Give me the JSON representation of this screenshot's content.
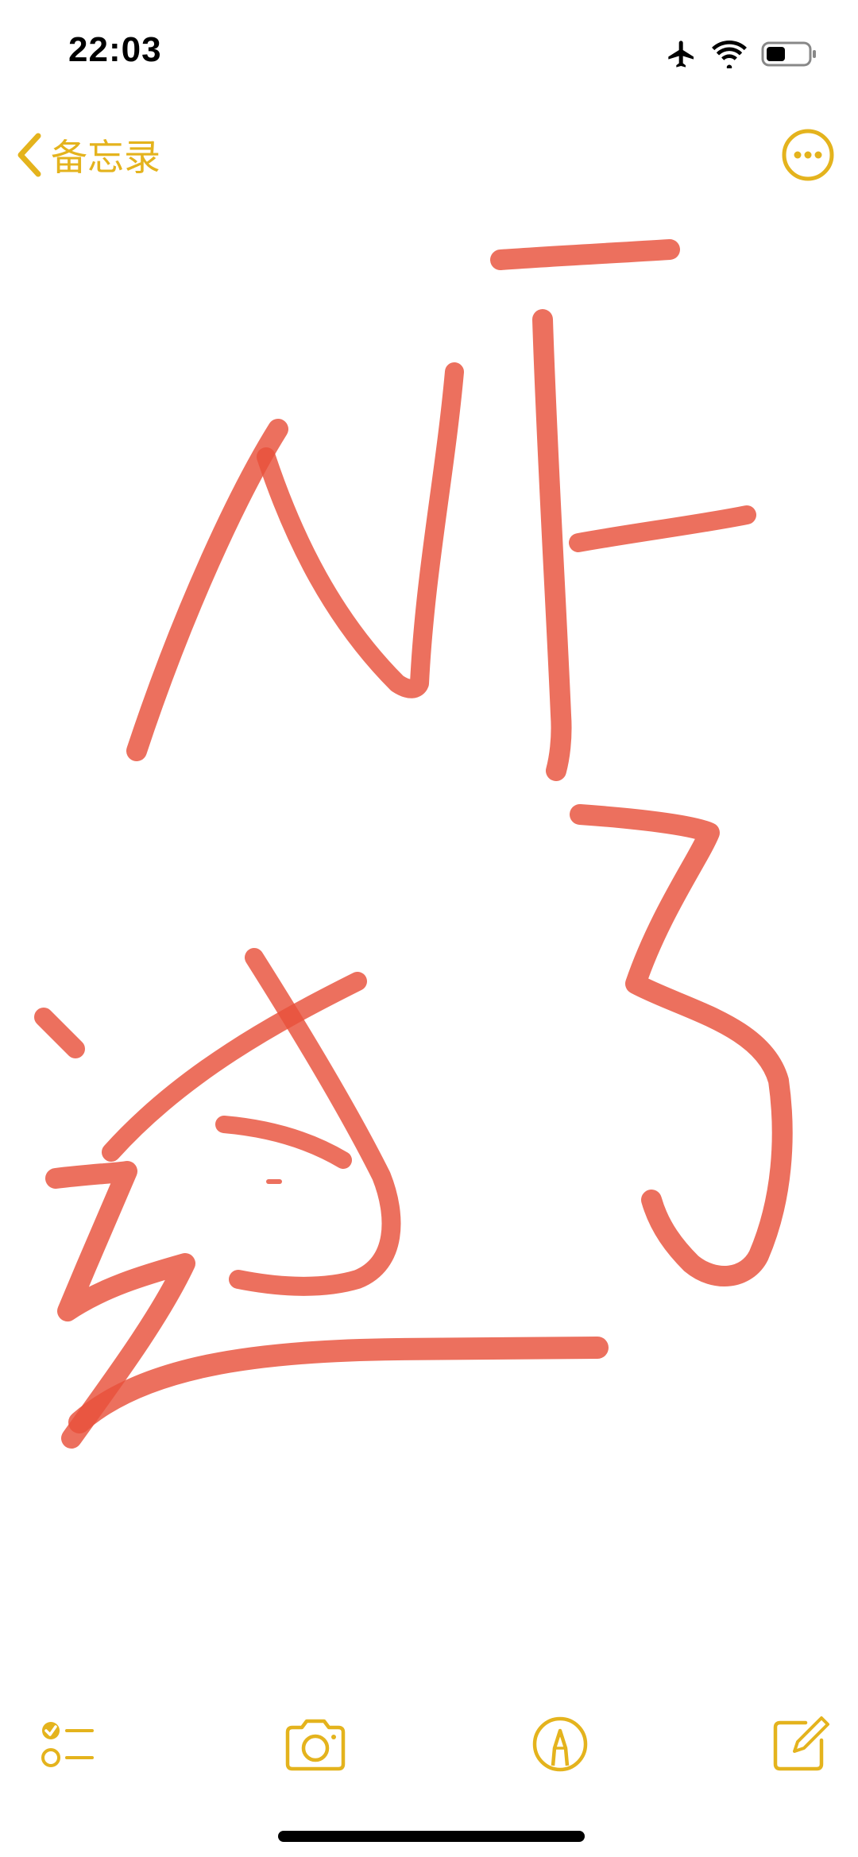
{
  "status_bar": {
    "time": "22:03",
    "icons": [
      "airplane-icon",
      "wifi-icon",
      "battery-icon"
    ],
    "battery_level": 0.45
  },
  "nav": {
    "back_label": "备忘录",
    "back_icon": "chevron-left-icon",
    "more_icon": "ellipsis-circle-icon"
  },
  "toolbar": {
    "items": [
      "checklist-icon",
      "camera-icon",
      "markup-pen-icon",
      "compose-icon"
    ]
  },
  "colors": {
    "accent": "#E4B31D",
    "ink": "#E8503A",
    "background": "#FFFFFF"
  }
}
